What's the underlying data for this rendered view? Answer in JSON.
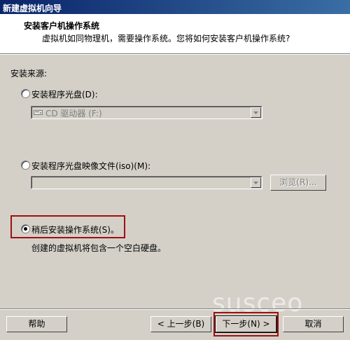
{
  "window": {
    "title": "新建虚拟机向导"
  },
  "header": {
    "title": "安装客户机操作系统",
    "subtitle": "虚拟机如同物理机，需要操作系统。您将如何安装客户机操作系统?"
  },
  "source_label": "安装来源:",
  "options": {
    "disc": {
      "label": "安装程序光盘(D):",
      "selected": false
    },
    "disc_combo": {
      "value": "CD 驱动器 (F:)",
      "icon": "cd-drive-icon"
    },
    "iso": {
      "label": "安装程序光盘映像文件(iso)(M):",
      "selected": false
    },
    "iso_combo": {
      "value": ""
    },
    "browse_label": "浏览(R)...",
    "later": {
      "label": "稍后安装操作系统(S)。",
      "selected": true,
      "description": "创建的虚拟机将包含一个空白硬盘。"
    }
  },
  "footer": {
    "help_label": "帮助",
    "back_label": "< 上一步(B)",
    "next_label": "下一步(N) >",
    "cancel_label": "取消"
  },
  "watermark": "susceo",
  "colors": {
    "highlight_box": "#a01010",
    "titlebar": "#0a246a"
  }
}
